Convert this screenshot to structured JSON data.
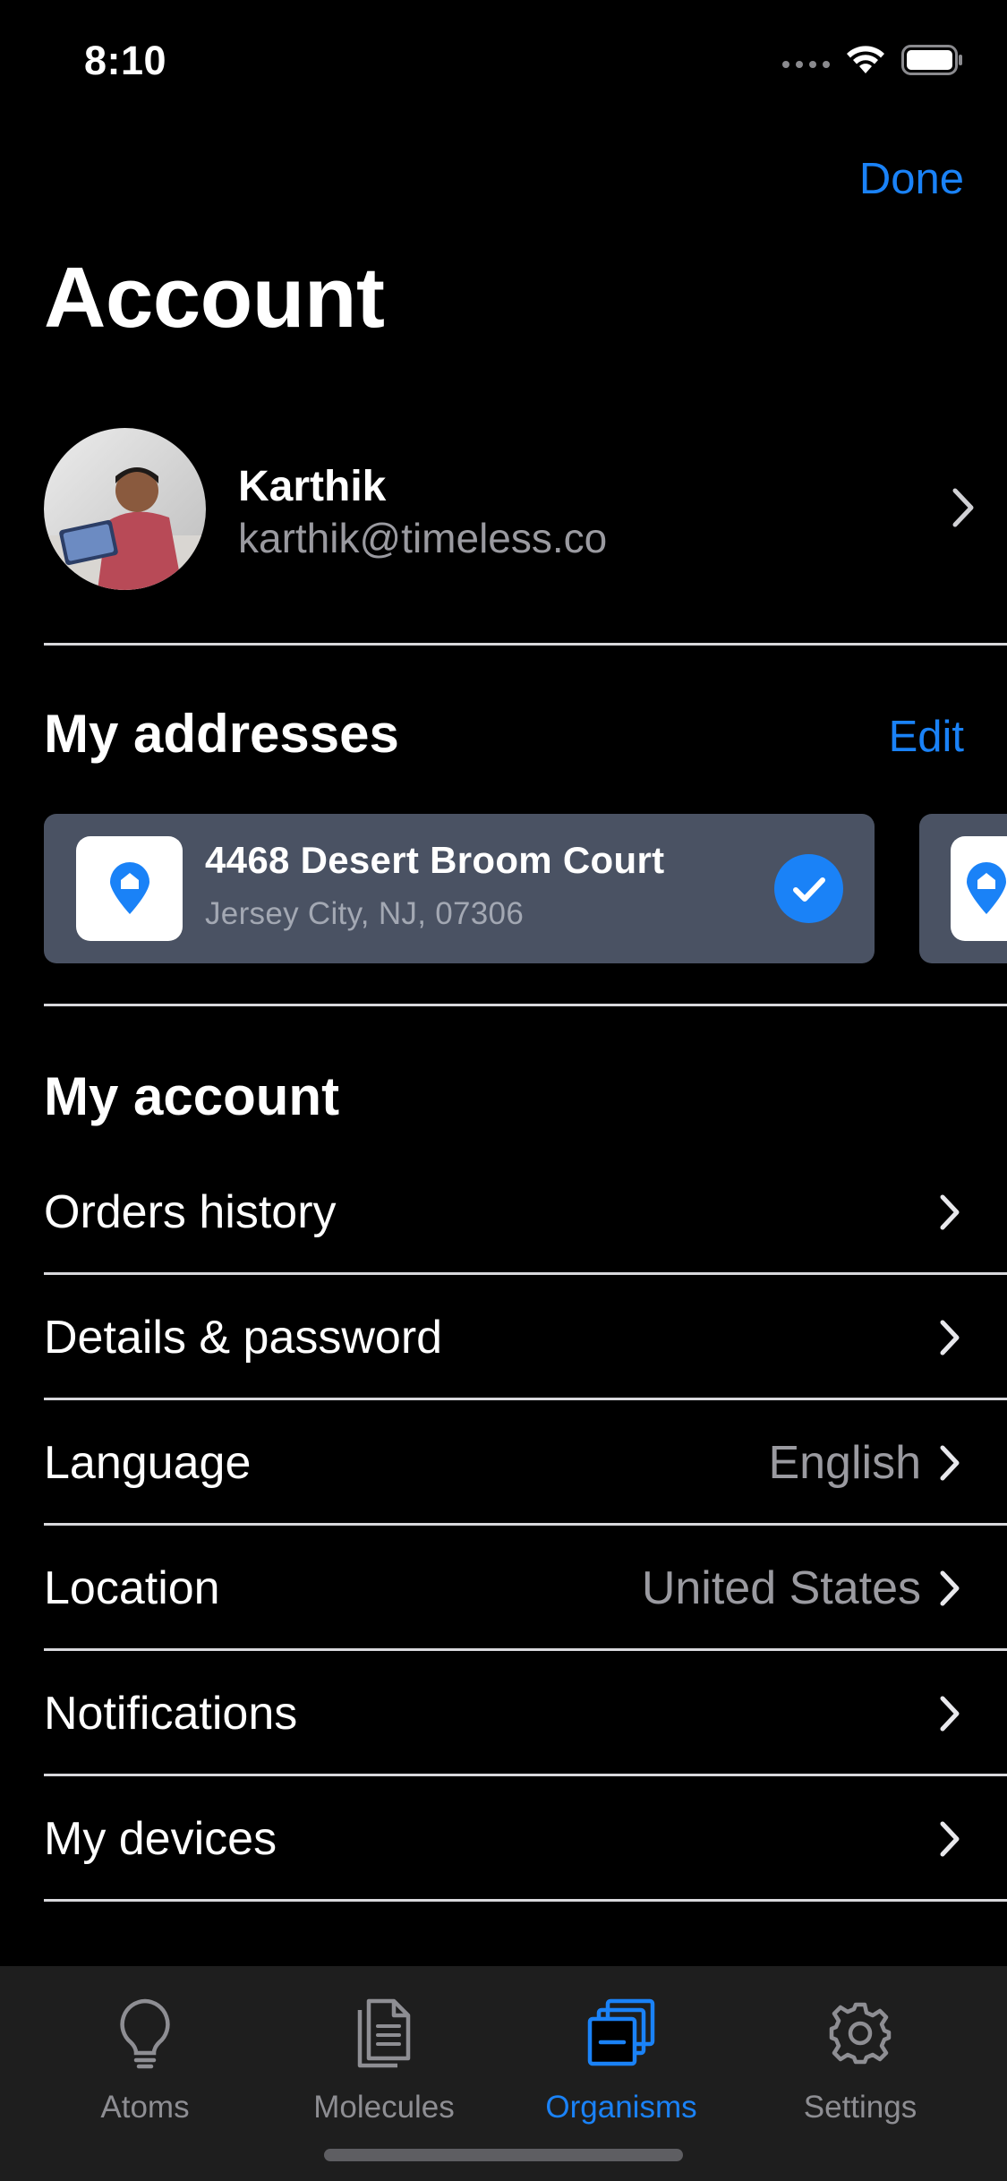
{
  "status_bar": {
    "time": "8:10"
  },
  "nav": {
    "done_label": "Done",
    "title": "Account"
  },
  "profile": {
    "name": "Karthik",
    "email": "karthik@timeless.co"
  },
  "addresses": {
    "title": "My addresses",
    "edit_label": "Edit",
    "items": [
      {
        "street": "4468 Desert Broom Court",
        "city": "Jersey City, NJ, 07306",
        "selected": true
      }
    ]
  },
  "account": {
    "title": "My account",
    "items": [
      {
        "label": "Orders history",
        "value": ""
      },
      {
        "label": "Details & password",
        "value": ""
      },
      {
        "label": "Language",
        "value": "English"
      },
      {
        "label": "Location",
        "value": "United States"
      },
      {
        "label": "Notifications",
        "value": ""
      },
      {
        "label": "My devices",
        "value": ""
      }
    ]
  },
  "tab_bar": {
    "items": [
      {
        "label": "Atoms",
        "icon": "lightbulb-icon",
        "active": false
      },
      {
        "label": "Molecules",
        "icon": "document-icon",
        "active": false
      },
      {
        "label": "Organisms",
        "icon": "stack-icon",
        "active": true
      },
      {
        "label": "Settings",
        "icon": "gear-icon",
        "active": false
      }
    ]
  },
  "colors": {
    "accent": "#1a82f7",
    "card": "#4a5263",
    "background": "#000000",
    "tab_bar": "#1e1e1e"
  }
}
